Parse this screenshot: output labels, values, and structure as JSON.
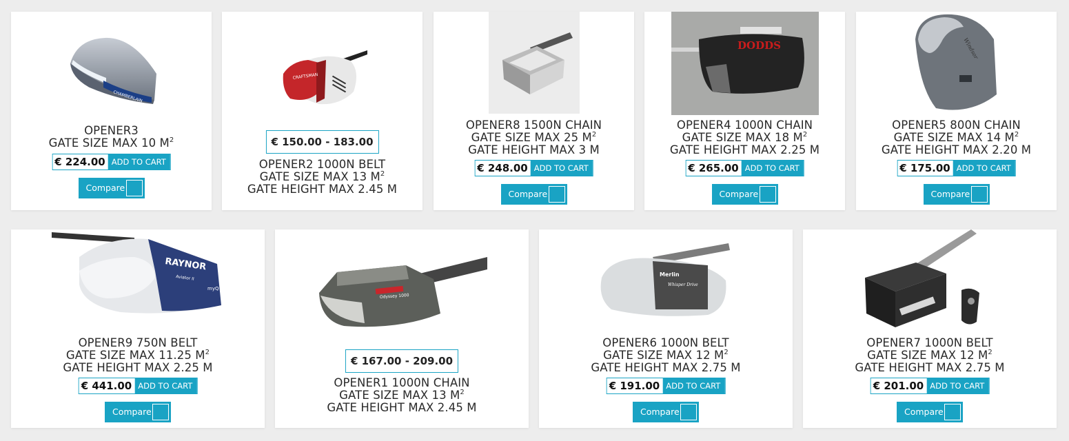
{
  "currency": "€",
  "add_to_cart_label": "ADD TO CART",
  "compare_label": "Compare",
  "accent_color": "#19a3c4",
  "products": [
    {
      "name": "OPENER3",
      "size_line": "GATE SIZE MAX 10 M",
      "height_line": "",
      "price": "€ 224.00",
      "price_range": ""
    },
    {
      "name": "OPENER2 1000N BELT",
      "size_line": "GATE SIZE MAX 13 M",
      "height_line": "GATE HEIGHT MAX 2.45 M",
      "price": "",
      "price_range": "€ 150.00 - 183.00"
    },
    {
      "name": "OPENER8 1500N CHAIN",
      "size_line": "GATE SIZE MAX 25 M",
      "height_line": "GATE HEIGHT MAX 3 M",
      "price": "€ 248.00",
      "price_range": ""
    },
    {
      "name": "OPENER4 1000N CHAIN",
      "size_line": "GATE SIZE MAX 18 M",
      "height_line": "GATE HEIGHT MAX 2.25 M",
      "price": "€ 265.00",
      "price_range": ""
    },
    {
      "name": "OPENER5 800N CHAIN",
      "size_line": "GATE SIZE MAX 14 M",
      "height_line": "GATE HEIGHT MAX 2.20 M",
      "price": "€ 175.00",
      "price_range": ""
    },
    {
      "name": "OPENER9 750N BELT",
      "size_line": "GATE SIZE MAX 11.25 M",
      "height_line": "GATE HEIGHT MAX 2.25 M",
      "price": "€ 441.00",
      "price_range": ""
    },
    {
      "name": "OPENER1 1000N CHAIN",
      "size_line": "GATE SIZE MAX 13 M",
      "height_line": "GATE HEIGHT MAX 2.45 M",
      "price": "",
      "price_range": "€ 167.00 - 209.00"
    },
    {
      "name": "OPENER6 1000N BELT",
      "size_line": "GATE SIZE MAX 12 M",
      "height_line": "GATE HEIGHT MAX 2.75 M",
      "price": "€ 191.00",
      "price_range": ""
    },
    {
      "name": "OPENER7 1000N BELT",
      "size_line": "GATE SIZE MAX 12 M",
      "height_line": "GATE HEIGHT MAX 2.75 M",
      "price": "€ 201.00",
      "price_range": ""
    }
  ],
  "superscript": "2",
  "image_labels": {
    "opener3": "CHAMBERLAIN",
    "opener2": "CRAFTSMAN",
    "opener4": "DODDS",
    "opener9": "RAYNOR",
    "opener9_sub": "Aviator II",
    "opener9_myq": "myQ",
    "opener1": "Odyssey 1000",
    "opener6": "Merlin",
    "opener6_sub": "Whisper Drive",
    "opener5": "Windsor"
  }
}
